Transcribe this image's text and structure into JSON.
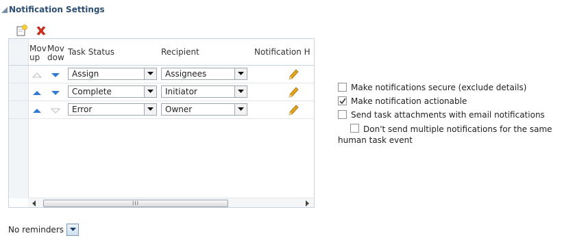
{
  "section": {
    "title": "Notification Settings"
  },
  "toolbar": {
    "add_icon": "add-row-icon",
    "delete_icon": "delete-row-icon"
  },
  "table": {
    "columns": {
      "move_up": "Mov up",
      "move_down": "Mov dow",
      "task_status": "Task Status",
      "recipient": "Recipient",
      "notification_header": "Notification H"
    },
    "rows": [
      {
        "task_status": "Assign",
        "recipient": "Assignees",
        "up_enabled": false,
        "down_enabled": true
      },
      {
        "task_status": "Complete",
        "recipient": "Initiator",
        "up_enabled": true,
        "down_enabled": true
      },
      {
        "task_status": "Error",
        "recipient": "Owner",
        "up_enabled": true,
        "down_enabled": false
      }
    ],
    "scrollbar": {
      "grip": "III"
    }
  },
  "reminders": {
    "value": "No reminders"
  },
  "options": [
    {
      "label": "Make notifications secure (exclude details)",
      "checked": false
    },
    {
      "label": "Make notification actionable",
      "checked": true
    },
    {
      "label": "Send task attachments with email notifications",
      "checked": false
    },
    {
      "label": "Don't send multiple notifications for the same human task event",
      "checked": false
    }
  ],
  "colors": {
    "accent": "#2c4e73",
    "arrow_active": "#2f7ad0",
    "arrow_inactive": "#b8bec5",
    "delete": "#cc2a1a",
    "pencil": "#e0a21a"
  }
}
